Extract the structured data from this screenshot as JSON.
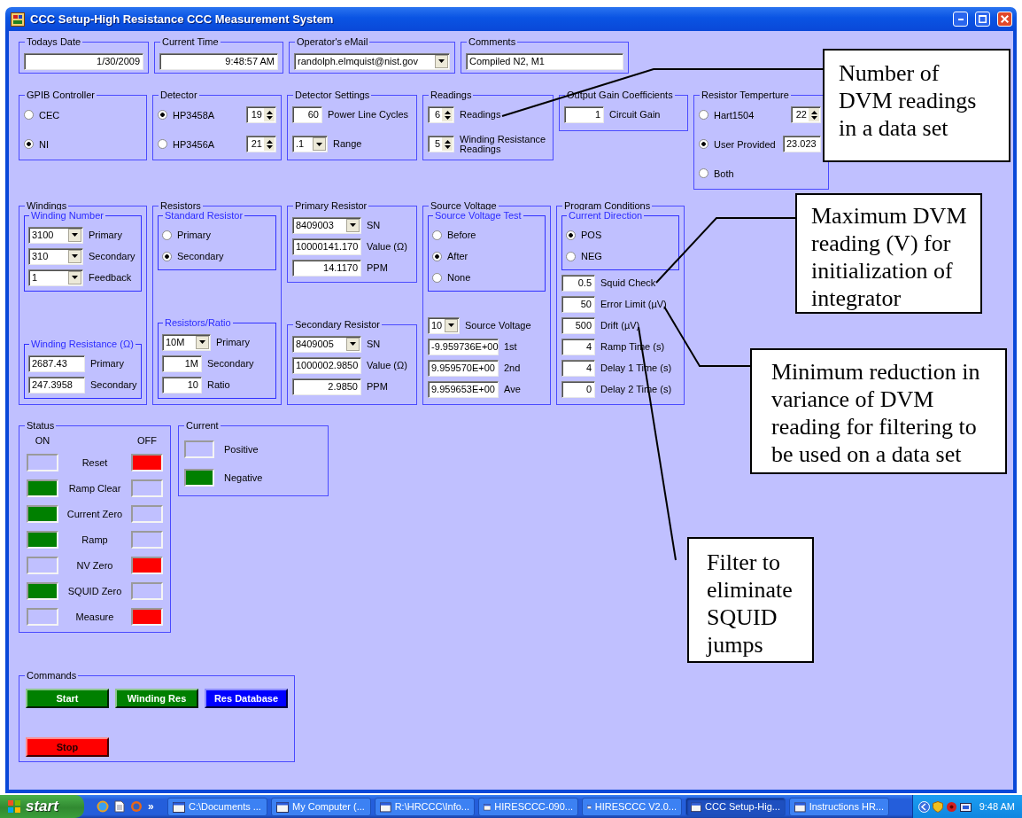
{
  "window": {
    "title": "CCC Setup-High Resistance CCC Measurement System"
  },
  "form_rows": [
    [
      {
        "kind": "box",
        "title": "Todays Date",
        "sections": [
          {
            "kind": "rows",
            "rows": [
              [
                {
                  "kind": "numfield",
                  "value": "1/30/2009"
                }
              ]
            ]
          }
        ]
      },
      {
        "kind": "box",
        "title": "Current Time",
        "sections": [
          {
            "kind": "rows",
            "rows": [
              [
                {
                  "kind": "numfield",
                  "value": "9:48:57 AM"
                }
              ]
            ]
          }
        ]
      },
      {
        "kind": "box",
        "title": "Operator's eMail",
        "sections": [
          {
            "kind": "rows",
            "rows": [
              [
                {
                  "kind": "combo",
                  "value": "randolph.elmquist@nist.gov"
                }
              ]
            ]
          }
        ]
      },
      {
        "kind": "box",
        "title": "Comments",
        "sections": [
          {
            "kind": "rows",
            "rows": [
              [
                {
                  "kind": "textfield",
                  "value": "Compiled N2, M1"
                }
              ]
            ]
          }
        ]
      }
    ],
    [
      {
        "kind": "box",
        "title": "GPIB Controller",
        "sections": [
          {
            "kind": "rows",
            "rows": [
              [
                {
                  "kind": "radio",
                  "label": "CEC",
                  "selected": false
                }
              ],
              [
                {
                  "kind": "radio",
                  "label": "NI",
                  "selected": true
                }
              ]
            ]
          }
        ]
      },
      {
        "kind": "box",
        "title": "Detector",
        "sections": [
          {
            "kind": "rows",
            "rows": [
              [
                {
                  "kind": "radio",
                  "label": "HP3458A",
                  "selected": true
                },
                {
                  "kind": "spin",
                  "value": "19"
                }
              ],
              [
                {
                  "kind": "radio",
                  "label": "HP3456A",
                  "selected": false
                },
                {
                  "kind": "spin",
                  "value": "21"
                }
              ]
            ]
          }
        ]
      },
      {
        "kind": "box",
        "title": "Detector Settings",
        "sections": [
          {
            "kind": "rows",
            "rows": [
              [
                {
                  "kind": "numfield",
                  "value": "60"
                },
                {
                  "kind": "label",
                  "text": "Power Line Cycles"
                }
              ],
              [
                {
                  "kind": "combo",
                  "value": ".1"
                },
                {
                  "kind": "label",
                  "text": "Range"
                }
              ]
            ]
          }
        ]
      },
      {
        "kind": "box",
        "title": "Readings",
        "sections": [
          {
            "kind": "rows",
            "rows": [
              [
                {
                  "kind": "spin",
                  "value": "6"
                },
                {
                  "kind": "label",
                  "text": "Readings"
                }
              ],
              [
                {
                  "kind": "spin",
                  "value": "5"
                },
                {
                  "kind": "label",
                  "text": "Winding Resistance Readings"
                }
              ]
            ]
          }
        ]
      },
      {
        "kind": "box",
        "title": "Output Gain Coefficients",
        "sections": [
          {
            "kind": "rows",
            "rows": [
              [
                {
                  "kind": "numfield",
                  "value": "1"
                },
                {
                  "kind": "label",
                  "text": "Circuit Gain"
                }
              ]
            ]
          }
        ]
      },
      {
        "kind": "box",
        "title": "Resistor Temperture",
        "sections": [
          {
            "kind": "rows",
            "rows": [
              [
                {
                  "kind": "radio",
                  "label": "Hart1504",
                  "selected": false
                },
                {
                  "kind": "spin",
                  "value": "22"
                }
              ],
              [
                {
                  "kind": "radio",
                  "label": "User Provided",
                  "selected": true
                },
                {
                  "kind": "textfield",
                  "value": "23.023"
                }
              ],
              [
                {
                  "kind": "radio",
                  "label": "Both",
                  "selected": false
                }
              ]
            ]
          }
        ]
      }
    ],
    [
      {
        "kind": "box",
        "title": "Windings",
        "sections": [
          {
            "kind": "subgroup",
            "title": "Winding Number",
            "rows": [
              [
                {
                  "kind": "combo",
                  "value": "3100"
                },
                {
                  "kind": "label",
                  "text": "Primary"
                }
              ],
              [
                {
                  "kind": "combo",
                  "value": "310"
                },
                {
                  "kind": "label",
                  "text": "Secondary"
                }
              ],
              [
                {
                  "kind": "combo",
                  "value": "1"
                },
                {
                  "kind": "label",
                  "text": "Feedback"
                }
              ]
            ]
          },
          {
            "kind": "subgroup",
            "title": "Winding Resistance (Ω)",
            "rows": [
              [
                {
                  "kind": "textfield",
                  "value": "2687.43"
                },
                {
                  "kind": "label",
                  "text": "Primary"
                }
              ],
              [
                {
                  "kind": "textfield",
                  "value": "247.3958"
                },
                {
                  "kind": "label",
                  "text": "Secondary"
                }
              ]
            ]
          }
        ]
      },
      {
        "kind": "box",
        "title": "Resistors",
        "sections": [
          {
            "kind": "subgroup",
            "title": "Standard Resistor",
            "rows": [
              [
                {
                  "kind": "radio",
                  "label": "Primary",
                  "selected": false
                }
              ],
              [
                {
                  "kind": "radio",
                  "label": "Secondary",
                  "selected": true
                }
              ]
            ]
          },
          {
            "kind": "subgroup",
            "title": "Resistors/Ratio",
            "rows": [
              [
                {
                  "kind": "combo",
                  "value": "10M"
                },
                {
                  "kind": "label",
                  "text": "Primary"
                }
              ],
              [
                {
                  "kind": "numfield",
                  "value": "1M"
                },
                {
                  "kind": "label",
                  "text": "Secondary"
                }
              ],
              [
                {
                  "kind": "numfield",
                  "value": "10"
                },
                {
                  "kind": "label",
                  "text": "Ratio"
                }
              ]
            ]
          }
        ]
      },
      {
        "kind": "stack",
        "groups": [
          {
            "kind": "box",
            "title": "Primary Resistor",
            "sections": [
              {
                "kind": "rows",
                "rows": [
                  [
                    {
                      "kind": "combo",
                      "value": "8409003"
                    },
                    {
                      "kind": "label",
                      "text": "SN"
                    }
                  ],
                  [
                    {
                      "kind": "numfield",
                      "value": "10000141.170"
                    },
                    {
                      "kind": "label",
                      "text": "Value (Ω)"
                    }
                  ],
                  [
                    {
                      "kind": "numfield",
                      "value": "14.1170"
                    },
                    {
                      "kind": "label",
                      "text": "PPM"
                    }
                  ]
                ]
              }
            ]
          },
          {
            "kind": "box",
            "title": "Secondary Resistor",
            "sections": [
              {
                "kind": "rows",
                "rows": [
                  [
                    {
                      "kind": "combo",
                      "value": "8409005"
                    },
                    {
                      "kind": "label",
                      "text": "SN"
                    }
                  ],
                  [
                    {
                      "kind": "numfield",
                      "value": "1000002.9850"
                    },
                    {
                      "kind": "label",
                      "text": "Value (Ω)"
                    }
                  ],
                  [
                    {
                      "kind": "numfield",
                      "value": "2.9850"
                    },
                    {
                      "kind": "label",
                      "text": "PPM"
                    }
                  ]
                ]
              }
            ]
          }
        ]
      },
      {
        "kind": "box",
        "title": "Source Voltage",
        "sections": [
          {
            "kind": "subgroup",
            "title": "Source Voltage Test",
            "rows": [
              [
                {
                  "kind": "radio",
                  "label": "Before",
                  "selected": false
                }
              ],
              [
                {
                  "kind": "radio",
                  "label": "After",
                  "selected": true
                }
              ],
              [
                {
                  "kind": "radio",
                  "label": "None",
                  "selected": false
                }
              ]
            ]
          },
          {
            "kind": "rows",
            "rows": [
              [
                {
                  "kind": "combo",
                  "value": "10"
                },
                {
                  "kind": "label",
                  "text": "Source Voltage"
                }
              ],
              [
                {
                  "kind": "textfield",
                  "value": "-9.959736E+00"
                },
                {
                  "kind": "label",
                  "text": "1st"
                }
              ],
              [
                {
                  "kind": "textfield",
                  "value": "9.959570E+00"
                },
                {
                  "kind": "label",
                  "text": "2nd"
                }
              ],
              [
                {
                  "kind": "textfield",
                  "value": "9.959653E+00"
                },
                {
                  "kind": "label",
                  "text": "Ave"
                }
              ]
            ]
          }
        ]
      },
      {
        "kind": "box",
        "title": "Program Conditions",
        "sections": [
          {
            "kind": "subgroup",
            "title": "Current Direction",
            "rows": [
              [
                {
                  "kind": "radio",
                  "label": "POS",
                  "selected": true
                }
              ],
              [
                {
                  "kind": "radio",
                  "label": "NEG",
                  "selected": false
                }
              ]
            ]
          },
          {
            "kind": "rows",
            "rows": [
              [
                {
                  "kind": "numfield",
                  "value": "0.5"
                },
                {
                  "kind": "label",
                  "text": "Squid Check"
                }
              ],
              [
                {
                  "kind": "numfield",
                  "value": "50"
                },
                {
                  "kind": "label",
                  "text": "Error Limit (µV)"
                }
              ],
              [
                {
                  "kind": "numfield",
                  "value": "500"
                },
                {
                  "kind": "label",
                  "text": "Drift (µV)"
                }
              ],
              [
                {
                  "kind": "numfield",
                  "value": "4"
                },
                {
                  "kind": "label",
                  "text": "Ramp Time (s)"
                }
              ],
              [
                {
                  "kind": "numfield",
                  "value": "4"
                },
                {
                  "kind": "label",
                  "text": "Delay 1 Time (s)"
                }
              ],
              [
                {
                  "kind": "numfield",
                  "value": "0"
                },
                {
                  "kind": "label",
                  "text": "Delay 2 Time (s)"
                }
              ]
            ]
          }
        ]
      }
    ],
    [
      {
        "kind": "status",
        "title": "Status",
        "on_heading": "ON",
        "off_heading": "OFF",
        "rows": [
          {
            "label": "Reset",
            "on": false,
            "off": true
          },
          {
            "label": "Ramp Clear",
            "on": true,
            "off": false
          },
          {
            "label": "Current Zero",
            "on": true,
            "off": false
          },
          {
            "label": "Ramp",
            "on": true,
            "off": false
          },
          {
            "label": "NV Zero",
            "on": false,
            "off": true
          },
          {
            "label": "SQUID Zero",
            "on": true,
            "off": false
          },
          {
            "label": "Measure",
            "on": false,
            "off": true
          }
        ]
      },
      {
        "kind": "current",
        "title": "Current",
        "rows": [
          {
            "label": "Positive",
            "lit": false
          },
          {
            "label": "Negative",
            "lit": true
          }
        ]
      }
    ],
    [
      {
        "kind": "commands",
        "title": "Commands",
        "buttons": [
          {
            "label": "Start",
            "color": "#008000"
          },
          {
            "label": "Winding Res",
            "color": "#008000"
          },
          {
            "label": "Res Database",
            "color": "#0000ff"
          },
          {
            "label": "Stop",
            "color": "#ff0000"
          }
        ]
      }
    ]
  ],
  "annotations": [
    {
      "text": "Number of DVM readings in a data set"
    },
    {
      "text": "Maximum DVM reading (V) for initialization of integrator"
    },
    {
      "text": "Minimum reduction in variance of DVM reading for filtering to be used on a data set"
    },
    {
      "text": "Filter to eliminate SQUID jumps"
    }
  ],
  "taskbar": {
    "start": "start",
    "quick_launch_more": "»",
    "tasks": [
      {
        "label": "C:\\Documents ...",
        "selected": false
      },
      {
        "label": "My Computer (...",
        "selected": false
      },
      {
        "label": "R:\\HRCCC\\Info...",
        "selected": false
      },
      {
        "label": "HIRESCCC-090...",
        "selected": false
      },
      {
        "label": "HIRESCCC V2.0...",
        "selected": false
      },
      {
        "label": "CCC Setup-Hig...",
        "selected": true
      },
      {
        "label": "Instructions HR...",
        "selected": false
      }
    ],
    "clock": "9:48 AM"
  }
}
